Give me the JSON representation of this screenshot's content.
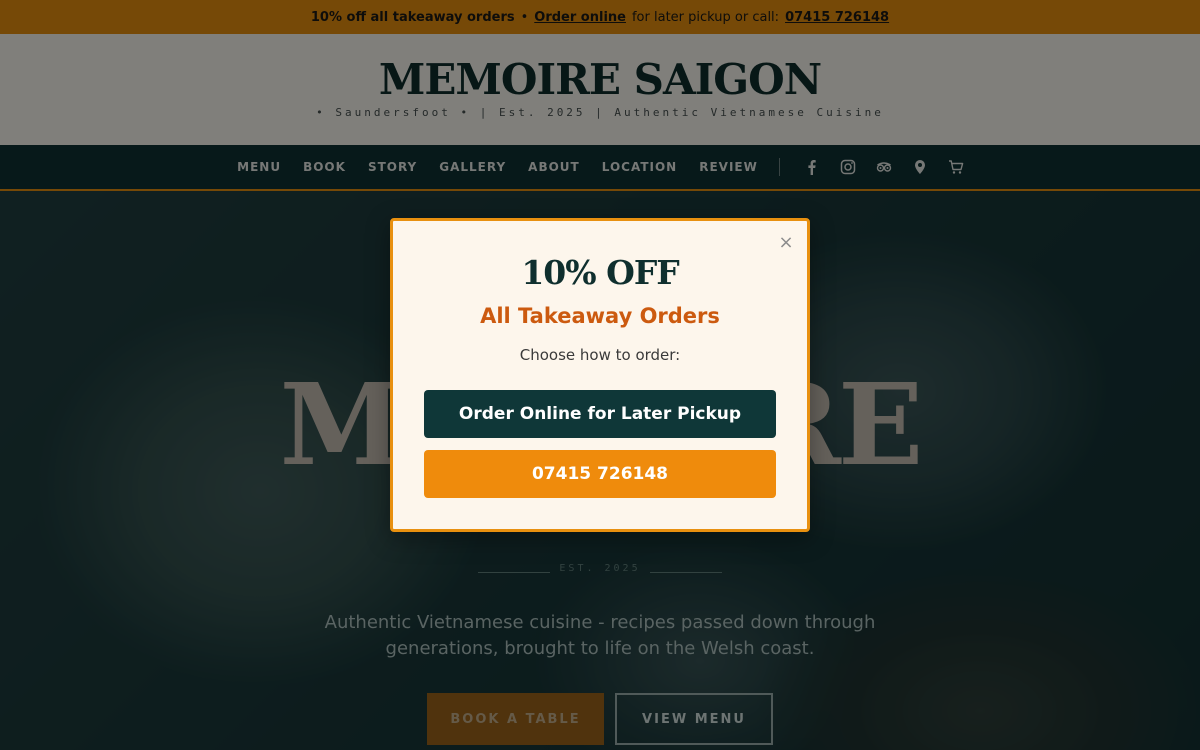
{
  "promo": {
    "offer": "10% off all takeaway orders",
    "separator": "•",
    "order_link": "Order online",
    "middle_text": "for later pickup or call:",
    "phone": "07415 726148"
  },
  "header": {
    "brand": "MEMOIRE SAIGON",
    "tagline": "• Saundersfoot • | Est. 2025 | Authentic Vietnamese Cuisine"
  },
  "nav": {
    "items": [
      "MENU",
      "BOOK",
      "STORY",
      "GALLERY",
      "ABOUT",
      "LOCATION",
      "REVIEW"
    ],
    "icons": [
      "facebook-icon",
      "instagram-icon",
      "tripadvisor-icon",
      "location-pin-icon",
      "cart-icon"
    ]
  },
  "hero": {
    "title": "MEMOIRE",
    "est": "EST. 2025",
    "description": "Authentic Vietnamese cuisine - recipes passed down through generations, brought to life on the Welsh coast.",
    "book_button": "BOOK A TABLE",
    "menu_button": "VIEW MENU"
  },
  "modal": {
    "close": "×",
    "headline": "10% OFF",
    "subheadline": "All Takeaway Orders",
    "prompt": "Choose how to order:",
    "order_online_button": "Order Online for Later Pickup",
    "phone_button": "07415 726148"
  },
  "colors": {
    "accent_orange": "#e8900f",
    "dark_teal": "#0f3234",
    "modal_sub": "#cc5a0f"
  }
}
